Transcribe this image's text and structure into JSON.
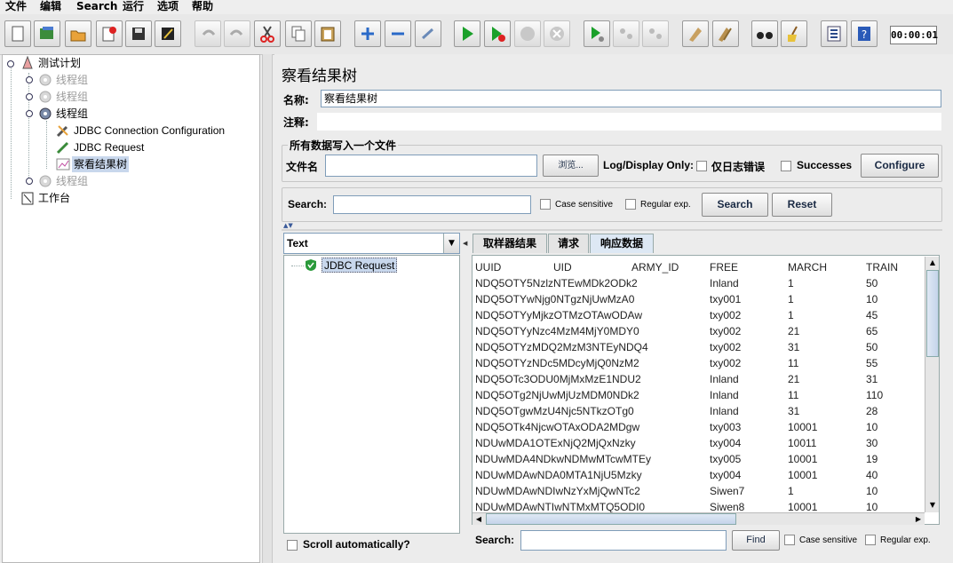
{
  "menu": [
    "文件",
    "编辑",
    "Search",
    "运行",
    "选项",
    "帮助"
  ],
  "toolbar": {
    "timer": "00:00:01",
    "icons": [
      "new-icon",
      "templates-icon",
      "open-icon",
      "close-icon",
      "save-icon",
      "save-as-icon",
      "undo-icon",
      "redo-icon",
      "cut-icon",
      "copy-icon",
      "paste-icon",
      "expand-icon",
      "collapse-icon",
      "toggle-icon",
      "start-icon",
      "start-no-pause-icon",
      "stop-icon",
      "shutdown-icon",
      "remote-start-icon",
      "remote-stop-icon",
      "remote-shutdown-icon",
      "clear-icon",
      "clear-all-icon",
      "search-icon",
      "reset-search-icon",
      "function-helper-icon",
      "help-icon"
    ]
  },
  "tree": {
    "items": [
      {
        "label": "测试计划",
        "level": 0,
        "icon": "test-plan-icon",
        "grey": false,
        "selected": false
      },
      {
        "label": "线程组",
        "level": 1,
        "icon": "gear-icon",
        "grey": true,
        "selected": false
      },
      {
        "label": "线程组",
        "level": 1,
        "icon": "gear-icon",
        "grey": true,
        "selected": false
      },
      {
        "label": "线程组",
        "level": 1,
        "icon": "gear-icon",
        "grey": false,
        "selected": false
      },
      {
        "label": "JDBC Connection Configuration",
        "level": 2,
        "icon": "wrench-icon",
        "grey": false,
        "selected": false
      },
      {
        "label": "JDBC Request",
        "level": 2,
        "icon": "pipette-icon",
        "grey": false,
        "selected": false
      },
      {
        "label": "察看结果树",
        "level": 2,
        "icon": "chart-icon",
        "grey": false,
        "selected": true
      },
      {
        "label": "线程组",
        "level": 1,
        "icon": "gear-icon",
        "grey": true,
        "selected": false
      },
      {
        "label": "工作台",
        "level": 0,
        "icon": "workbench-icon",
        "grey": false,
        "selected": false
      }
    ]
  },
  "panel": {
    "title": "察看结果树",
    "name_label": "名称:",
    "name_value": "察看结果树",
    "comment_label": "注释:",
    "file_group_title": "所有数据写入一个文件",
    "filename_label": "文件名",
    "browse_label": "浏览...",
    "log_display_label": "Log/Display Only:",
    "errors_only_label": "仅日志错误",
    "successes_label": "Successes",
    "configure_label": "Configure",
    "search_label": "Search:",
    "case_sensitive_label": "Case sensitive",
    "regex_label": "Regular exp.",
    "search_button": "Search",
    "reset_button": "Reset"
  },
  "results": {
    "renderer_selected": "Text",
    "sample_label": "JDBC Request",
    "scroll_auto_label": "Scroll automatically?",
    "tabs": [
      "取样器结果",
      "请求",
      "响应数据"
    ],
    "active_tab": 2,
    "columns": [
      "UUID",
      "UID",
      "ARMY_ID",
      "FREE",
      "MARCH",
      "TRAIN"
    ],
    "rows": [
      [
        "NDQ5OTY5NzlzNTEwMDk2ODk2",
        "Inland",
        "1",
        "50"
      ],
      [
        "NDQ5OTYwNjg0NTgzNjUwMzA0",
        "txy001",
        "1",
        "10"
      ],
      [
        "NDQ5OTYyMjkzOTMzOTAwODAw",
        "txy002",
        "1",
        "45"
      ],
      [
        "NDQ5OTYyNzc4MzM4MjY0MDY0",
        "txy002",
        "21",
        "65"
      ],
      [
        "NDQ5OTYzMDQ2MzM3NTEyNDQ4",
        "txy002",
        "31",
        "50"
      ],
      [
        "NDQ5OTYzNDc5MDcyMjQ0NzM2",
        "txy002",
        "11",
        "55"
      ],
      [
        "NDQ5OTc3ODU0MjMxMzE1NDU2",
        "Inland",
        "21",
        "31"
      ],
      [
        "NDQ5OTg2NjUwMjUzMDM0NDk2",
        "Inland",
        "11",
        "110"
      ],
      [
        "NDQ5OTgwMzU4Njc5NTkzOTg0",
        "Inland",
        "31",
        "28"
      ],
      [
        "NDQ5OTk4NjcwOTAxODA2MDgw",
        "txy003",
        "10001",
        "10"
      ],
      [
        "NDUwMDA1OTExNjQ2MjQxNzky",
        "txy004",
        "10011",
        "30"
      ],
      [
        "NDUwMDA4NDkwNDMwMTcwMTEy",
        "txy005",
        "10001",
        "19"
      ],
      [
        "NDUwMDAwNDA0MTA1NjU5Mzky",
        "txy004",
        "10001",
        "40"
      ],
      [
        "NDUwMDAwNDIwNzYxMjQwNTc2",
        "Siwen7",
        "1",
        "10"
      ],
      [
        "NDUwMDAwNTIwNTMxMTQ5ODI0",
        "Siwen8",
        "10001",
        "10"
      ]
    ],
    "find_label": "Search:",
    "find_button": "Find",
    "find_case_label": "Case sensitive",
    "find_regex_label": "Regular exp."
  }
}
